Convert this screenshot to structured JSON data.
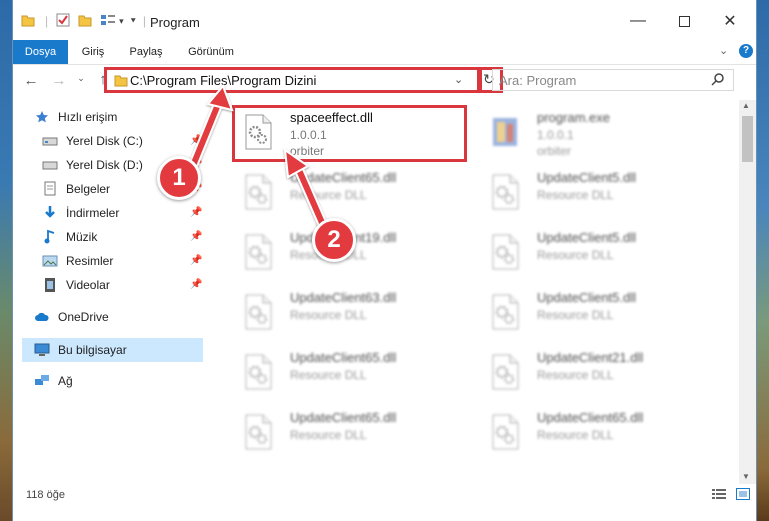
{
  "window": {
    "title": "Program"
  },
  "ribbon": {
    "tabs": [
      "Dosya",
      "Giriş",
      "Paylaş",
      "Görünüm"
    ]
  },
  "address": {
    "path": "C:\\Program Files\\Program Dizini"
  },
  "search": {
    "placeholder": "Ara: Program"
  },
  "nav": {
    "items": [
      {
        "label": "Hızlı erişim",
        "icon": "star-icon"
      },
      {
        "label": "Yerel Disk (C:)",
        "icon": "drive-icon",
        "pinned": true
      },
      {
        "label": "Yerel Disk (D:)",
        "icon": "drive-icon",
        "pinned": true
      },
      {
        "label": "Belgeler",
        "icon": "documents-icon",
        "pinned": true
      },
      {
        "label": "İndirmeler",
        "icon": "download-icon",
        "pinned": true
      },
      {
        "label": "Müzik",
        "icon": "music-icon",
        "pinned": true
      },
      {
        "label": "Resimler",
        "icon": "pictures-icon",
        "pinned": true
      },
      {
        "label": "Videolar",
        "icon": "video-icon",
        "pinned": true
      },
      {
        "label": "OneDrive",
        "icon": "cloud-icon"
      },
      {
        "label": "Bu bilgisayar",
        "icon": "computer-icon",
        "selected": true
      },
      {
        "label": "Ağ",
        "icon": "network-icon"
      }
    ]
  },
  "files": [
    {
      "name": "spaceeffect.dll",
      "sub1": "1.0.0.1",
      "sub2": "orbiter"
    },
    {
      "name": "program.exe",
      "sub1": "1.0.0.1",
      "sub2": "orbiter"
    },
    {
      "name": "UpdateClient65.dll",
      "sub1": "Resource DLL"
    },
    {
      "name": "UpdateClient5.dll",
      "sub1": "Resource DLL"
    },
    {
      "name": "UpdateClient19.dll",
      "sub1": "Resource DLL"
    },
    {
      "name": "UpdateClient5.dll",
      "sub1": "Resource DLL"
    },
    {
      "name": "UpdateClient63.dll",
      "sub1": "Resource DLL"
    },
    {
      "name": "UpdateClient5.dll",
      "sub1": "Resource DLL"
    },
    {
      "name": "UpdateClient65.dll",
      "sub1": "Resource DLL"
    },
    {
      "name": "UpdateClient21.dll",
      "sub1": "Resource DLL"
    },
    {
      "name": "UpdateClient65.dll",
      "sub1": "Resource DLL"
    },
    {
      "name": "UpdateClient65.dll",
      "sub1": "Resource DLL"
    }
  ],
  "status": {
    "count": "118 öğe"
  },
  "callouts": {
    "one": "1",
    "two": "2"
  },
  "colors": {
    "accent": "#1979ca",
    "highlight": "#d9363e"
  }
}
